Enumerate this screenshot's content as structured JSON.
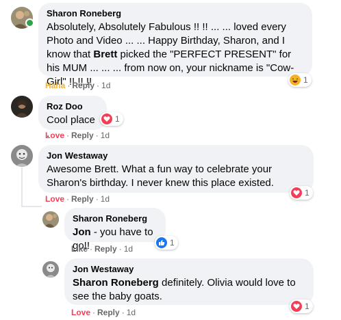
{
  "comments": [
    {
      "author": "Sharon Roneberg",
      "text": "Absolutely, Absolutely Fabulous !! !! ... ... loved every Photo and Video ... ... Happy Birthday, Sharon, and I know that ",
      "mention": "Brett",
      "text_after": " picked the \"PERFECT PRESENT\" for his MUM ... ... ... from now on, your nickname is \"Cow-Girl\" !! !! !!",
      "reaction_label": "Haha",
      "reply_label": "Reply",
      "time": "1d",
      "reaction_icon": "haha-emoji-icon",
      "reaction_count": "1",
      "online": true,
      "accent": "#f7b125"
    },
    {
      "author": "Roz Doo",
      "text": "Cool place .",
      "reaction_label": "Love",
      "reply_label": "Reply",
      "time": "1d",
      "reaction_icon": "heart-icon",
      "reaction_count": "1",
      "accent": "#f33e58"
    },
    {
      "author": "Jon Westaway",
      "text": "Awesome Brett. What a fun way to celebrate your Sharon's birthday. I never knew this place existed.",
      "reaction_label": "Love",
      "reply_label": "Reply",
      "time": "1d",
      "reaction_icon": "heart-icon",
      "reaction_count": "1",
      "accent": "#f33e58"
    },
    {
      "author": "Sharon Roneberg",
      "mention": "Jon",
      "text_after": " - you have to go!!",
      "reaction_label": "Like",
      "reply_label": "Reply",
      "time": "1d",
      "reaction_icon": "thumbs-up-icon",
      "reaction_count": "1",
      "accent": "#1877f2"
    },
    {
      "author": "Jon Westaway",
      "mention": "Sharon Roneberg",
      "text_after": " definitely. Olivia would love to see the baby goats.",
      "reaction_label": "Love",
      "reply_label": "Reply",
      "time": "1d",
      "reaction_icon": "heart-icon",
      "reaction_count": "1",
      "accent": "#f33e58"
    }
  ],
  "separator": "·"
}
